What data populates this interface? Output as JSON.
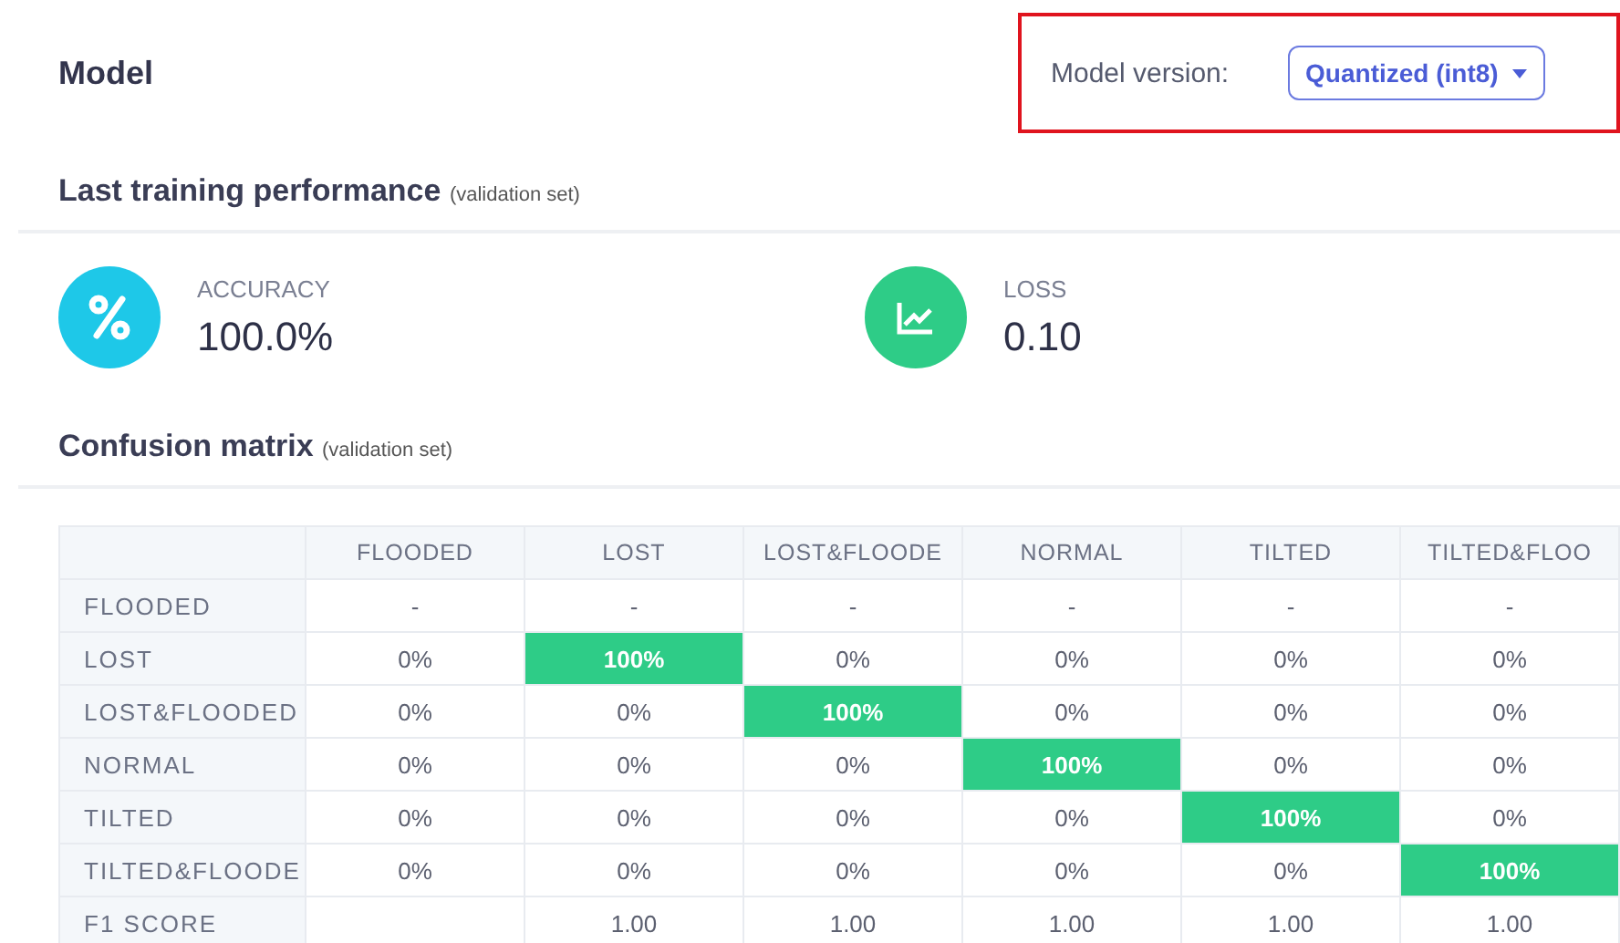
{
  "title": "Model",
  "model_version": {
    "label": "Model version:",
    "value": "Quantized (int8)",
    "annotated": true
  },
  "performance": {
    "title": "Last training performance",
    "note": "(validation set)",
    "metrics": [
      {
        "kind": "accuracy",
        "label": "ACCURACY",
        "value": "100.0%"
      },
      {
        "kind": "loss",
        "label": "LOSS",
        "value": "0.10"
      }
    ]
  },
  "confusion_matrix": {
    "title": "Confusion matrix",
    "note": "(validation set)",
    "columns": [
      "FLOODED",
      "LOST",
      "LOST&FLOODE",
      "NORMAL",
      "TILTED",
      "TILTED&FLOO"
    ],
    "rows": [
      {
        "label": "FLOODED",
        "cells": [
          {
            "value": "-",
            "highlighted": false
          },
          {
            "value": "-",
            "highlighted": false
          },
          {
            "value": "-",
            "highlighted": false
          },
          {
            "value": "-",
            "highlighted": false
          },
          {
            "value": "-",
            "highlighted": false
          },
          {
            "value": "-",
            "highlighted": false
          }
        ]
      },
      {
        "label": "LOST",
        "cells": [
          {
            "value": "0%",
            "highlighted": false
          },
          {
            "value": "100%",
            "highlighted": true
          },
          {
            "value": "0%",
            "highlighted": false
          },
          {
            "value": "0%",
            "highlighted": false
          },
          {
            "value": "0%",
            "highlighted": false
          },
          {
            "value": "0%",
            "highlighted": false
          }
        ]
      },
      {
        "label": "LOST&FLOODED",
        "cells": [
          {
            "value": "0%",
            "highlighted": false
          },
          {
            "value": "0%",
            "highlighted": false
          },
          {
            "value": "100%",
            "highlighted": true
          },
          {
            "value": "0%",
            "highlighted": false
          },
          {
            "value": "0%",
            "highlighted": false
          },
          {
            "value": "0%",
            "highlighted": false
          }
        ]
      },
      {
        "label": "NORMAL",
        "cells": [
          {
            "value": "0%",
            "highlighted": false
          },
          {
            "value": "0%",
            "highlighted": false
          },
          {
            "value": "0%",
            "highlighted": false
          },
          {
            "value": "100%",
            "highlighted": true
          },
          {
            "value": "0%",
            "highlighted": false
          },
          {
            "value": "0%",
            "highlighted": false
          }
        ]
      },
      {
        "label": "TILTED",
        "cells": [
          {
            "value": "0%",
            "highlighted": false
          },
          {
            "value": "0%",
            "highlighted": false
          },
          {
            "value": "0%",
            "highlighted": false
          },
          {
            "value": "0%",
            "highlighted": false
          },
          {
            "value": "100%",
            "highlighted": true
          },
          {
            "value": "0%",
            "highlighted": false
          }
        ]
      },
      {
        "label": "TILTED&FLOODE",
        "cells": [
          {
            "value": "0%",
            "highlighted": false
          },
          {
            "value": "0%",
            "highlighted": false
          },
          {
            "value": "0%",
            "highlighted": false
          },
          {
            "value": "0%",
            "highlighted": false
          },
          {
            "value": "0%",
            "highlighted": false
          },
          {
            "value": "100%",
            "highlighted": true
          }
        ]
      },
      {
        "label": "F1 SCORE",
        "cells": [
          {
            "highlighted": false
          },
          {
            "value": "1.00",
            "highlighted": false
          },
          {
            "value": "1.00",
            "highlighted": false
          },
          {
            "value": "1.00",
            "highlighted": false
          },
          {
            "value": "1.00",
            "highlighted": false
          },
          {
            "value": "1.00",
            "highlighted": false
          }
        ]
      }
    ]
  }
}
